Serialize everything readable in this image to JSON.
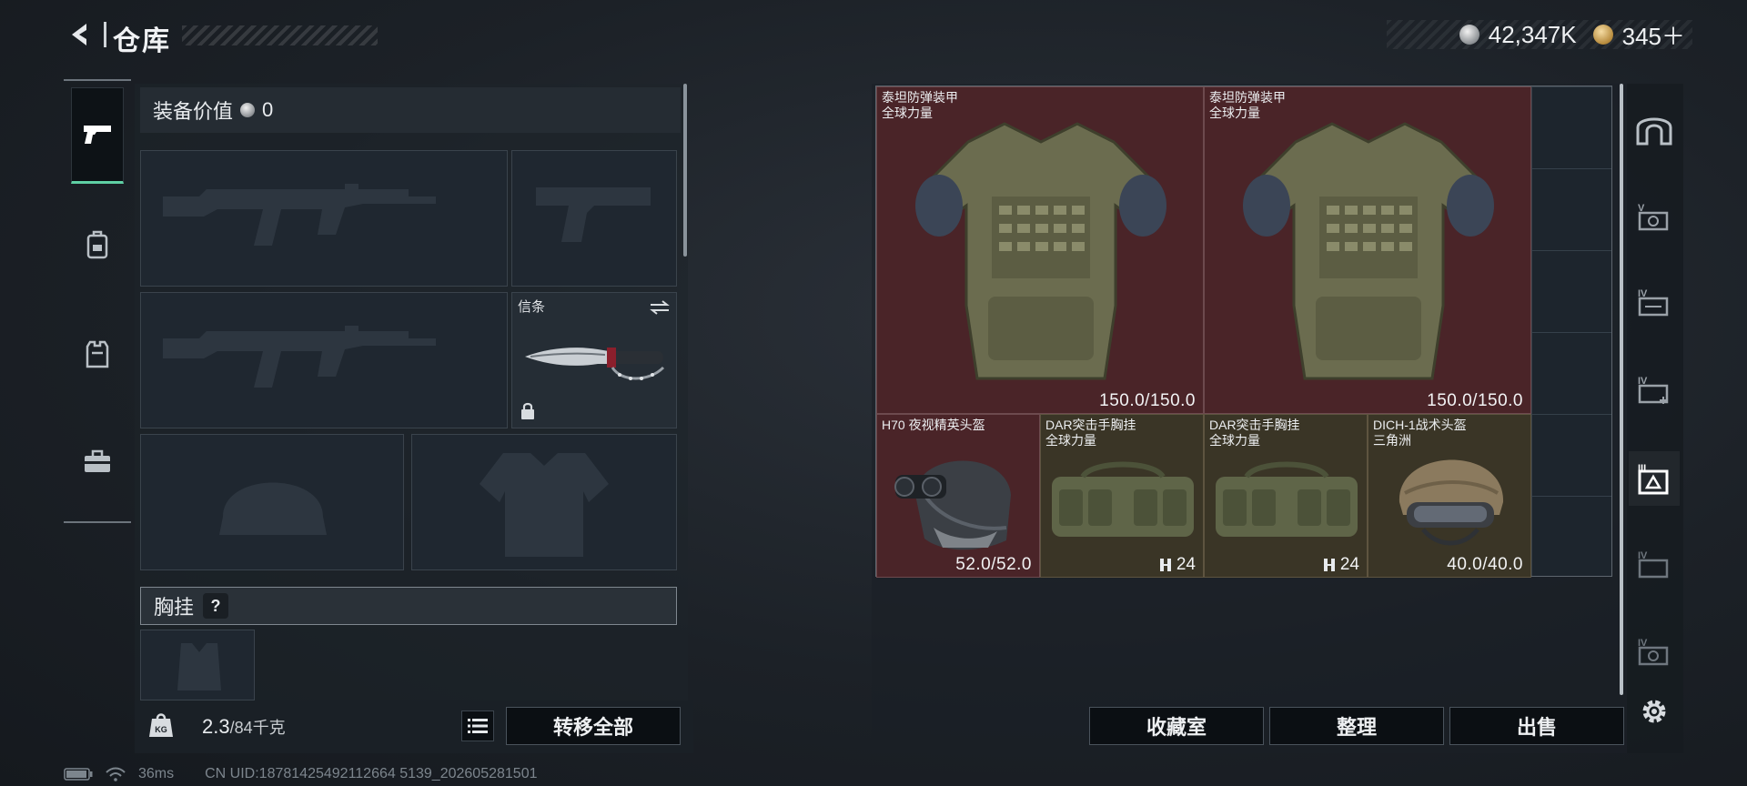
{
  "header": {
    "title": "仓库",
    "currency": [
      {
        "icon": "silver-coin-icon",
        "value": "42,347K"
      },
      {
        "icon": "gold-coin-icon",
        "value": "345＋"
      }
    ]
  },
  "side_tabs": [
    {
      "icon": "pistol-icon",
      "active": true
    },
    {
      "icon": "backpack-icon",
      "active": false
    },
    {
      "icon": "vest-icon",
      "active": false
    },
    {
      "icon": "toolbox-icon",
      "active": false
    }
  ],
  "loadout": {
    "equip_value_label": "装备价值",
    "equip_value": "0",
    "melee_label": "信条",
    "vest_label": "胸挂",
    "help": "?",
    "weight_value": "2.3",
    "weight_capacity": "/84千克",
    "transfer_all": "转移全部"
  },
  "stash": {
    "items": [
      {
        "name": "泰坦防弹装甲",
        "sub": "全球力量",
        "dur": "150.0/150.0",
        "rarity": "red"
      },
      {
        "name": "泰坦防弹装甲",
        "sub": "全球力量",
        "dur": "150.0/150.0",
        "rarity": "red"
      },
      {
        "name": "H70 夜视精英头盔",
        "sub": "",
        "dur": "52.0/52.0",
        "rarity": "red"
      },
      {
        "name": "DAR突击手胸挂",
        "sub": "全球力量",
        "cap": "24",
        "rarity": "gold"
      },
      {
        "name": "DAR突击手胸挂",
        "sub": "全球力量",
        "cap": "24",
        "rarity": "gold"
      },
      {
        "name": "DICH-1战术头盔",
        "sub": "三角洲",
        "dur": "40.0/40.0",
        "rarity": "gold"
      }
    ],
    "buttons": {
      "collection": "收藏室",
      "sort": "整理",
      "sell": "出售"
    }
  },
  "status": {
    "ping": "36ms",
    "uid": "CN UID:18781425492112664 5139_202605281501"
  },
  "colors": {
    "accent_green": "#5fd0a4",
    "red_rarity": "#4a2428",
    "gold_rarity": "#3a3526"
  }
}
